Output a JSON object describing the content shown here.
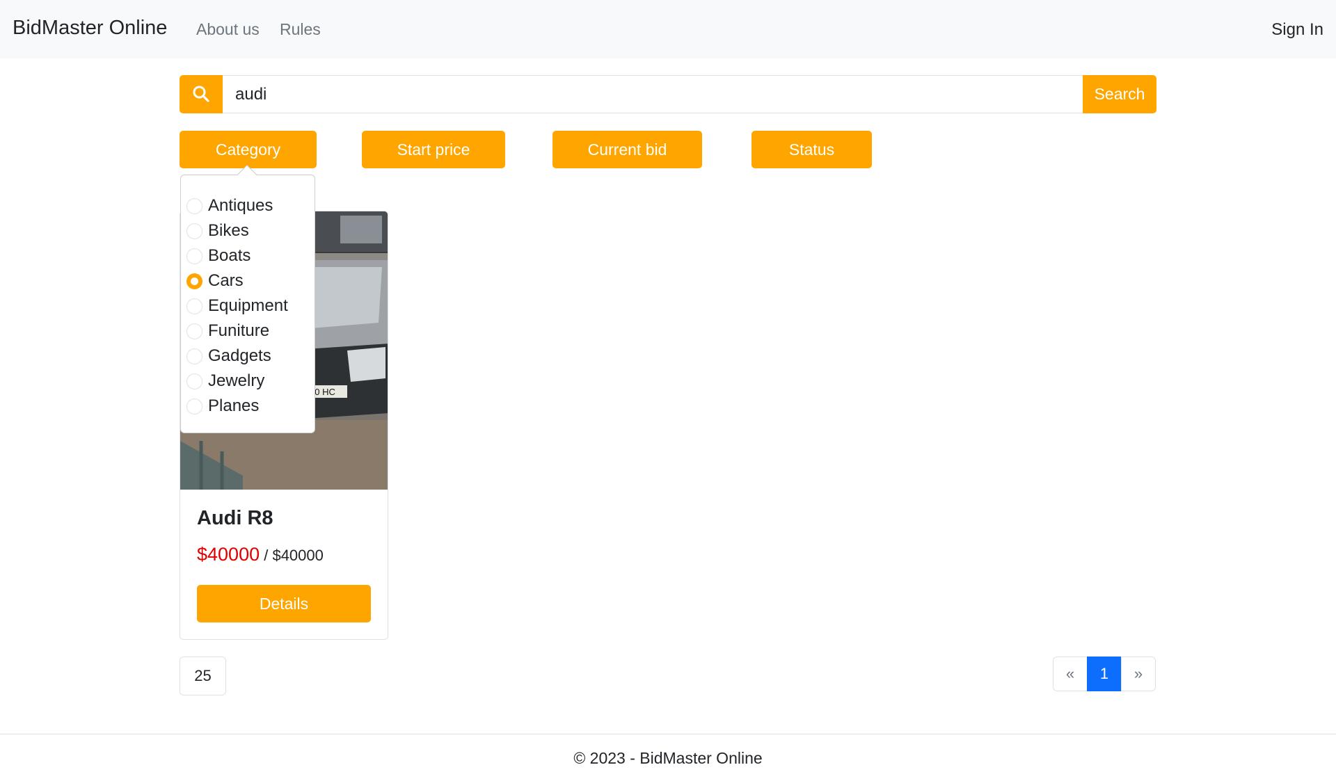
{
  "navbar": {
    "brand": "BidMaster Online",
    "links": [
      "About us",
      "Rules"
    ],
    "sign_in": "Sign In"
  },
  "search": {
    "value": "audi",
    "button_label": "Search",
    "icon": "search-icon"
  },
  "filters": {
    "category": "Category",
    "start_price": "Start price",
    "current_bid": "Current bid",
    "status": "Status"
  },
  "category_dropdown": {
    "options": [
      {
        "label": "Antiques",
        "checked": false
      },
      {
        "label": "Bikes",
        "checked": false
      },
      {
        "label": "Boats",
        "checked": false
      },
      {
        "label": "Cars",
        "checked": true
      },
      {
        "label": "Equipment",
        "checked": false
      },
      {
        "label": "Funiture",
        "checked": false
      },
      {
        "label": "Gadgets",
        "checked": false
      },
      {
        "label": "Jewelry",
        "checked": false
      },
      {
        "label": "Planes",
        "checked": false
      }
    ]
  },
  "listing": {
    "title": "Audi R8",
    "current_bid": "$40000",
    "separator": " / ",
    "start_price": "$40000",
    "details_label": "Details",
    "plate_text": "20 HC"
  },
  "page_size": "25",
  "pagination": {
    "prev": "«",
    "current": "1",
    "next": "»"
  },
  "footer": {
    "text": "© 2023 - BidMaster Online"
  },
  "colors": {
    "accent": "#ffa500",
    "price_red": "#e00000",
    "active_page": "#0d6efd"
  }
}
